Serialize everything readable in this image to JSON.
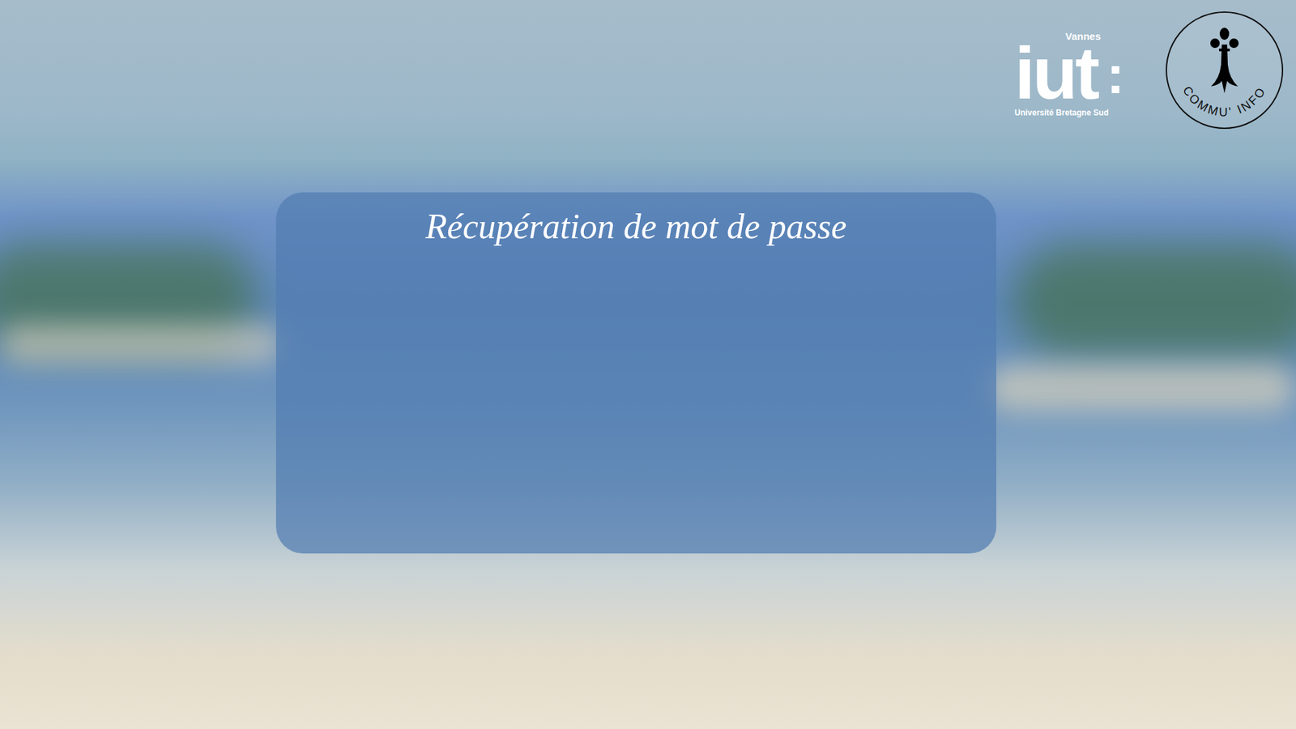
{
  "page": {
    "title": "Récupération de mot de passe"
  },
  "logos": {
    "iut": {
      "city": "Vannes",
      "name": "iut",
      "colon": ":",
      "university": "Université Bretagne Sud"
    },
    "club": {
      "name": "COMMU' INFO"
    }
  }
}
